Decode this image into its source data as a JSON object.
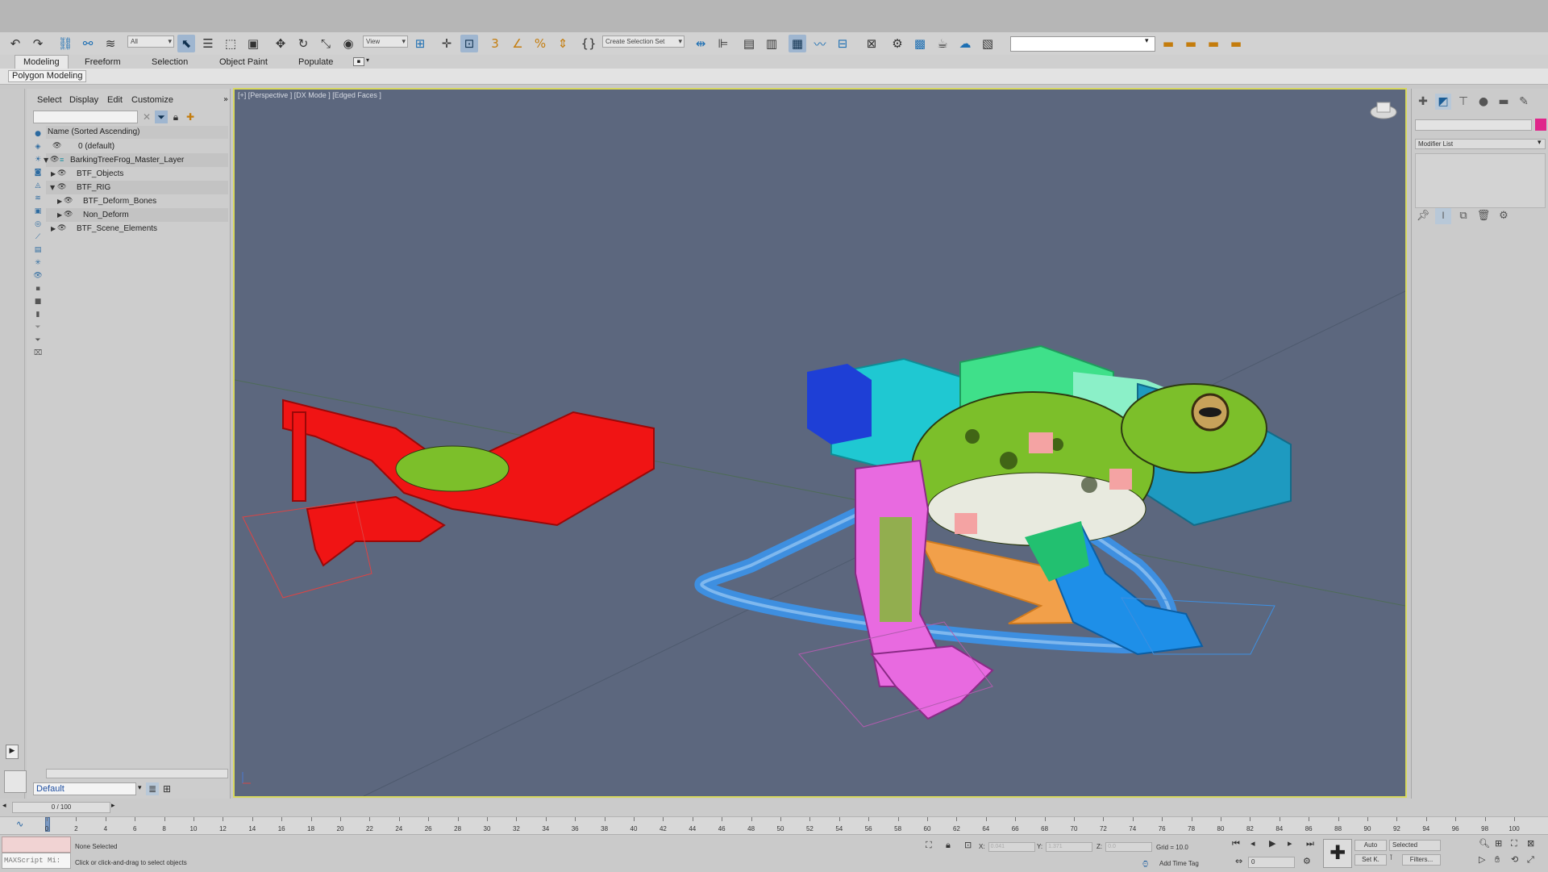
{
  "toolbar": {
    "selection_filter": "All",
    "reference_coord": "View",
    "selection_set": "Create Selection Set"
  },
  "ribbon": {
    "tabs": [
      "Modeling",
      "Freeform",
      "Selection",
      "Object Paint",
      "Populate"
    ],
    "panel_label": "Polygon Modeling"
  },
  "scene_explorer": {
    "menus": [
      "Select",
      "Display",
      "Edit",
      "Customize"
    ],
    "column_header": "Name (Sorted Ascending)",
    "rows": [
      {
        "label": "0 (default)",
        "indent": 0
      },
      {
        "label": "BarkingTreeFrog_Master_Layer",
        "indent": 0
      },
      {
        "label": "BTF_Objects",
        "indent": 1
      },
      {
        "label": "BTF_RIG",
        "indent": 1
      },
      {
        "label": "BTF_Deform_Bones",
        "indent": 2
      },
      {
        "label": "Non_Deform",
        "indent": 2
      },
      {
        "label": "BTF_Scene_Elements",
        "indent": 1
      }
    ],
    "layer": "Default"
  },
  "viewport": {
    "label": "[+] [Perspective ] [DX Mode ] [Edged Faces ]"
  },
  "command_panel": {
    "modifier_list": "Modifier List",
    "object_color": "#e0258a"
  },
  "time": {
    "frame_display": "0 / 100",
    "ticks": [
      0,
      2,
      4,
      6,
      8,
      10,
      12,
      14,
      16,
      18,
      20,
      22,
      24,
      26,
      28,
      30,
      32,
      34,
      36,
      38,
      40,
      42,
      44,
      46,
      48,
      50,
      52,
      54,
      56,
      58,
      60,
      62,
      64,
      66,
      68,
      70,
      72,
      74,
      76,
      78,
      80,
      82,
      84,
      86,
      88,
      90,
      92,
      94,
      96,
      98,
      100
    ]
  },
  "status": {
    "maxscript": "MAXScript Mi:",
    "selection": "None Selected",
    "prompt": "Click or click-and-drag to select objects",
    "x_label": "X:",
    "y_label": "Y:",
    "z_label": "Z:",
    "x_value": "0.041",
    "y_value": "1.371",
    "z_value": "0.0",
    "grid": "Grid = 10.0",
    "add_time_tag": "Add Time Tag",
    "auto": "Auto",
    "set_key": "Set K.",
    "selected": "Selected",
    "filters": "Filters...",
    "frame": "0"
  }
}
